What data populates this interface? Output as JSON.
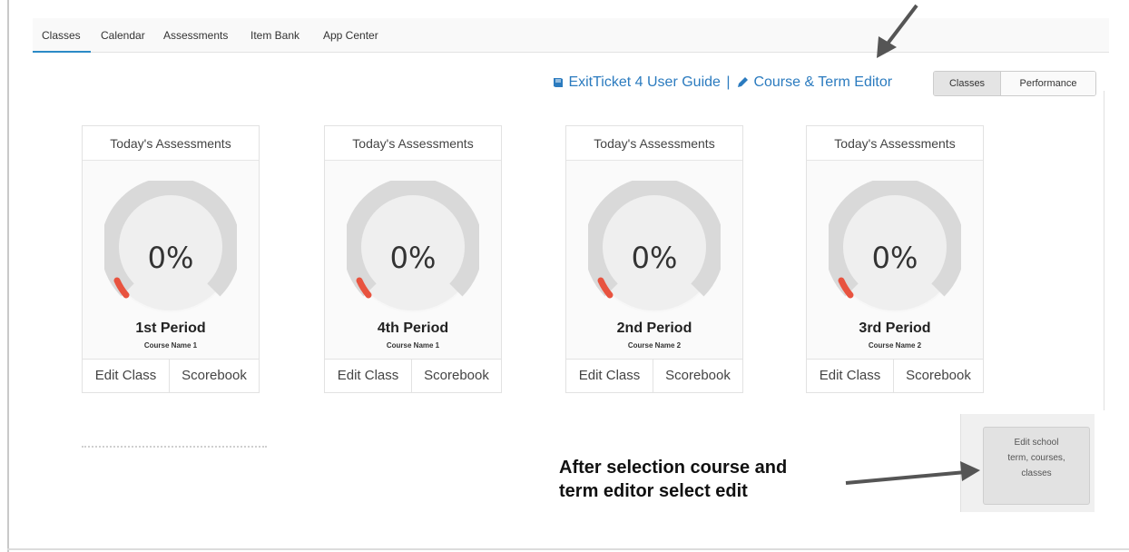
{
  "tabs": [
    {
      "label": "Classes",
      "active": true
    },
    {
      "label": "Calendar"
    },
    {
      "label": "Assessments"
    },
    {
      "label": "Item Bank"
    },
    {
      "label": "App Center"
    }
  ],
  "header": {
    "user_guide_link": "ExitTicket 4 User Guide",
    "separator": "|",
    "course_term_link": "Course & Term Editor"
  },
  "view_toggle": {
    "options": [
      "Classes",
      "Performance"
    ],
    "selected": "Classes"
  },
  "cards": [
    {
      "header": "Today's Assessments",
      "percent": "0%",
      "period": "1st Period",
      "course": "Course Name 1",
      "edit_label": "Edit Class",
      "scorebook_label": "Scorebook"
    },
    {
      "header": "Today's Assessments",
      "percent": "0%",
      "period": "4th Period",
      "course": "Course Name 1",
      "edit_label": "Edit Class",
      "scorebook_label": "Scorebook"
    },
    {
      "header": "Today's Assessments",
      "percent": "0%",
      "period": "2nd Period",
      "course": "Course Name 2",
      "edit_label": "Edit Class",
      "scorebook_label": "Scorebook"
    },
    {
      "header": "Today's Assessments",
      "percent": "0%",
      "period": "3rd Period",
      "course": "Course Name 2",
      "edit_label": "Edit Class",
      "scorebook_label": "Scorebook"
    }
  ],
  "gauge": {
    "value": 0,
    "track_color": "#d9d9d9",
    "fill_color": "#e8533f"
  },
  "edit_button": {
    "lines": [
      "Edit school",
      "term, courses,",
      "classes"
    ]
  },
  "annotation": {
    "line1": "After selection course and",
    "line2": "term editor select edit"
  },
  "colors": {
    "link": "#2b7bbf",
    "accent": "#2b8ac6",
    "arrow": "#555555"
  }
}
